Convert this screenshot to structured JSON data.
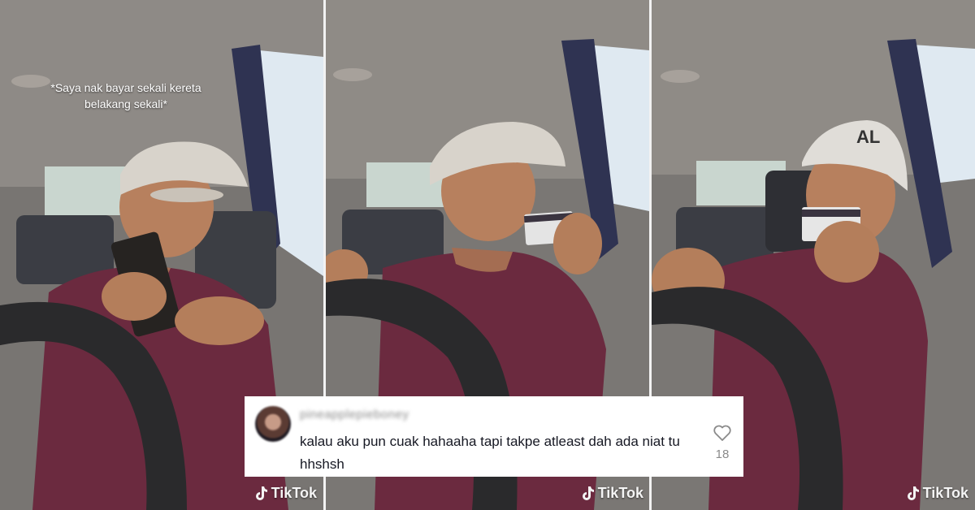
{
  "caption": "*Saya nak bayar sekali kereta belakang sekali*",
  "watermark": "TikTok",
  "comment": {
    "username": "pineapplepieboney",
    "text": "kalau aku pun cuak hahaaha tapi takpe atleast dah ada niat tu hhshsh",
    "likes": "18"
  },
  "colors": {
    "shirt": "#6b2a3f",
    "cap": "#d8d3cb",
    "skin": "#b7805e",
    "wheel": "#2a2a2c"
  }
}
